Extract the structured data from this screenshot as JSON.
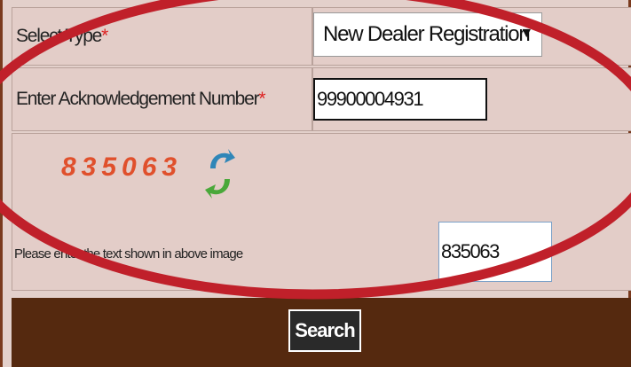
{
  "form": {
    "select_type": {
      "label": "Select Type",
      "required_mark": "*",
      "selected_value": "New Dealer Registration",
      "caret": "▼"
    },
    "ack_number": {
      "label": "Enter Acknowledgement Number",
      "required_mark": "*",
      "value": "99900004931"
    },
    "captcha": {
      "image_text": "835063",
      "refresh_icon": "refresh-arrows-icon",
      "hint": "Please enter the text shown in above image",
      "input_value": "835063"
    },
    "search_label": "Search"
  },
  "colors": {
    "footer": "#55290f",
    "highlight_oval": "#c0202a",
    "captcha": "#e0502c"
  }
}
